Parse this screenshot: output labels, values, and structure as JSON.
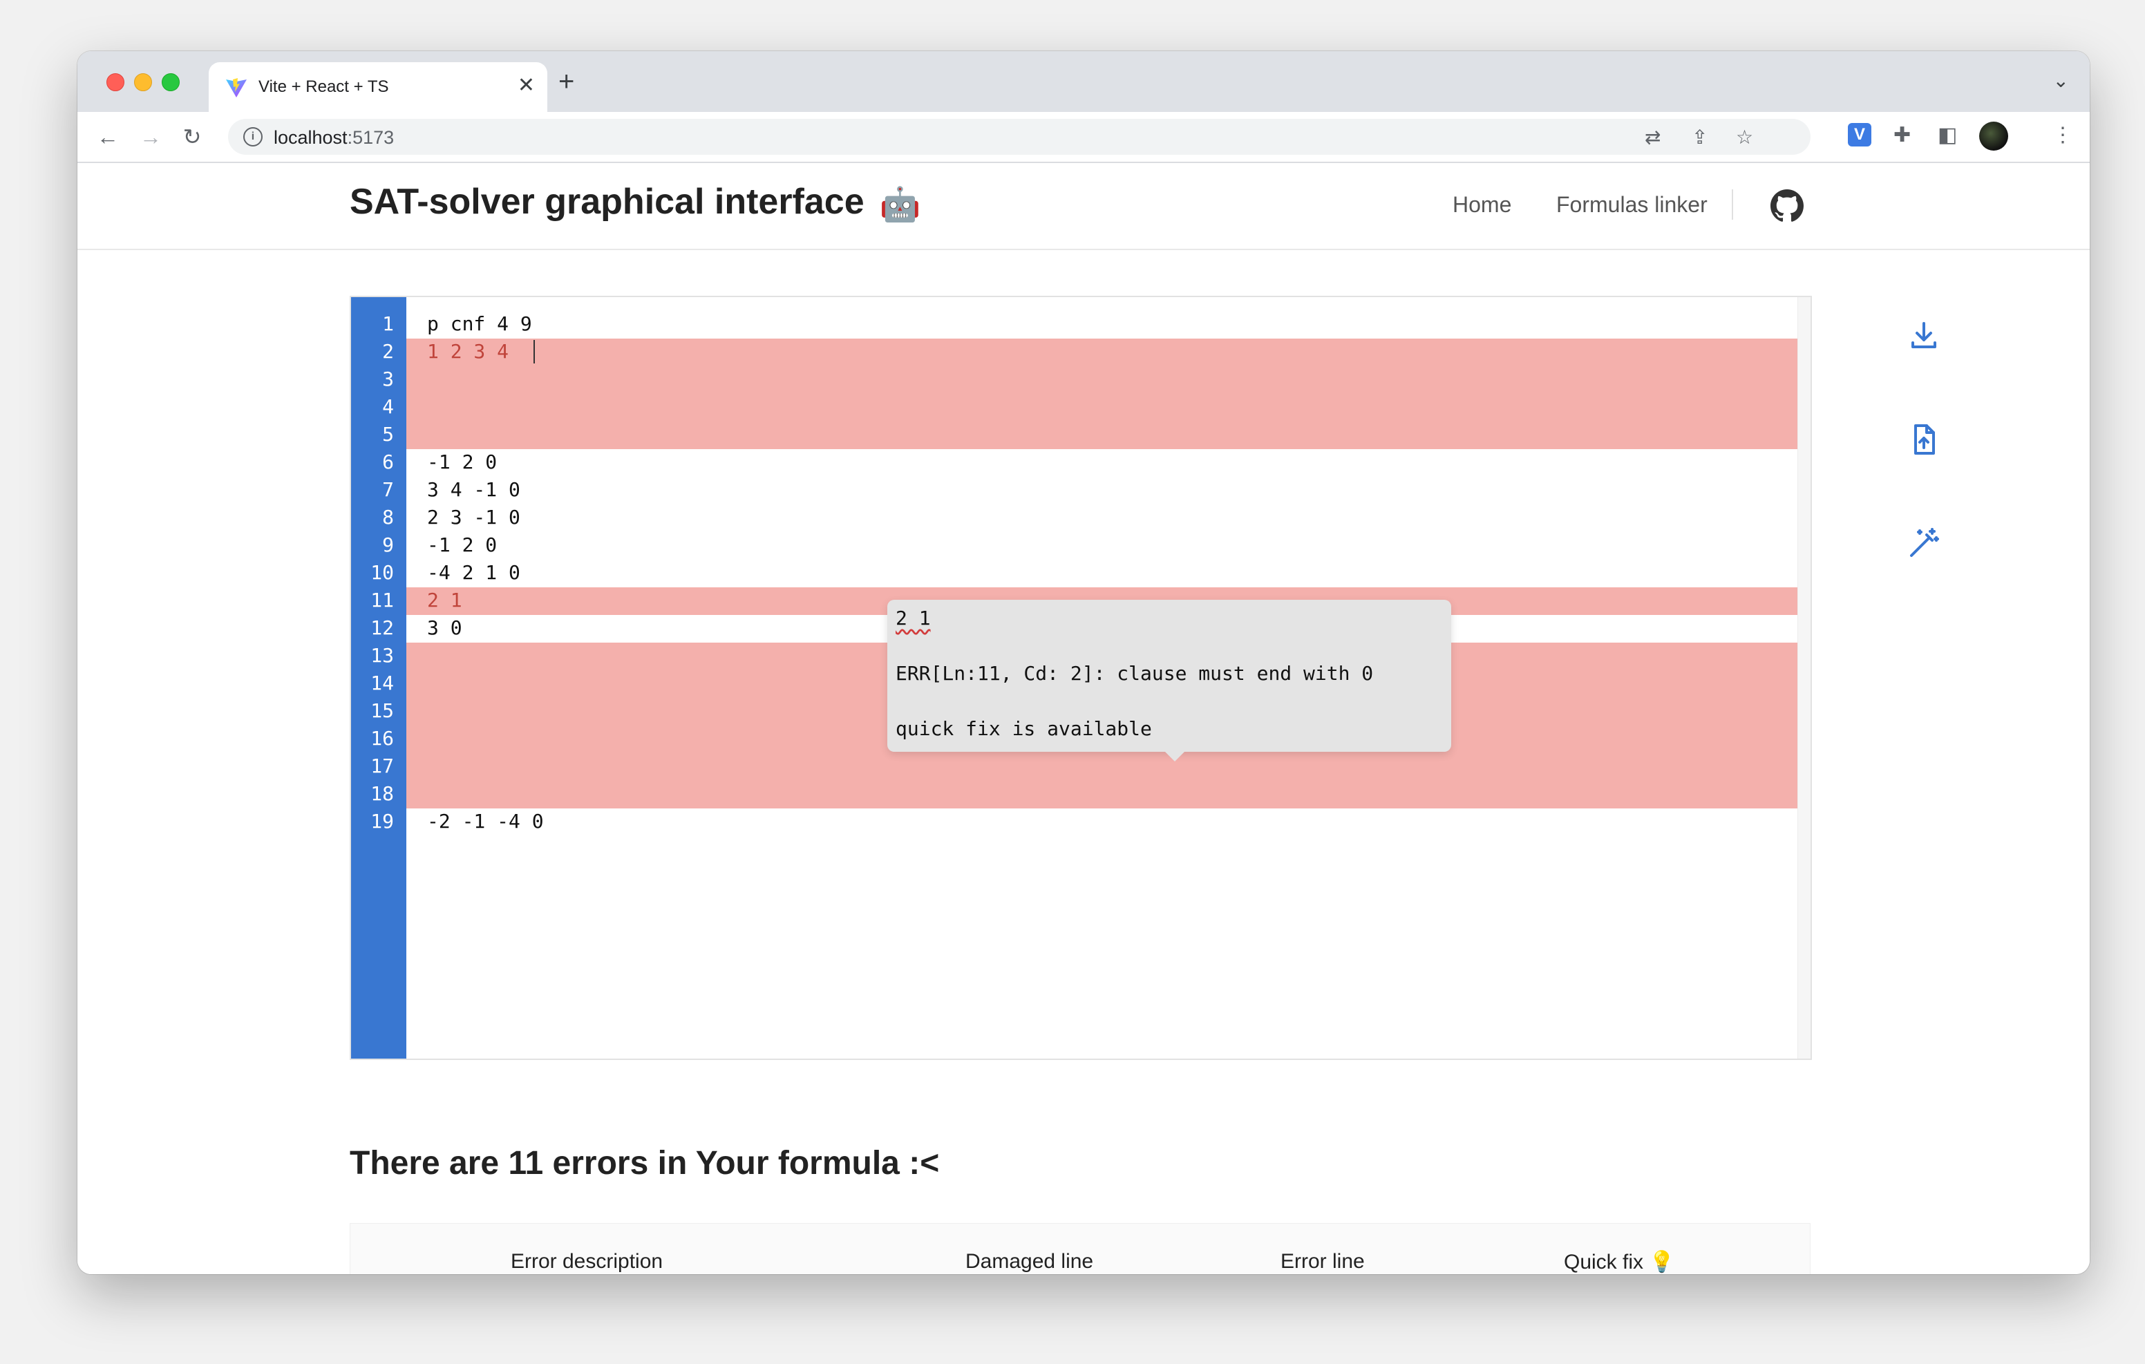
{
  "browser": {
    "tab_title": "Vite + React + TS",
    "url_host": "localhost",
    "url_port": ":5173"
  },
  "header": {
    "title": "SAT-solver graphical interface",
    "title_emoji": "🤖",
    "nav": [
      "Home",
      "Formulas linker"
    ]
  },
  "editor": {
    "line_numbers": [
      "1",
      "2",
      "3",
      "4",
      "5",
      "6",
      "7",
      "8",
      "9",
      "10",
      "11",
      "12",
      "13",
      "14",
      "15",
      "16",
      "17",
      "18",
      "19"
    ],
    "lines": {
      "l1": "p cnf 4 9",
      "l2": "1 2 3 4",
      "l6": "-1 2 0",
      "l7": "3 4 -1 0",
      "l8": "2 3 -1 0",
      "l9": "-1 2 0",
      "l10": "-4 2 1 0",
      "l11": "2 1",
      "l12": "3 0",
      "l19": "-2 -1 -4 0"
    },
    "error_line_numbers": [
      2,
      3,
      4,
      5,
      11,
      13,
      14,
      15,
      16,
      17,
      18
    ],
    "tooltip": {
      "title": "2 1",
      "message": "ERR[Ln:11, Cd: 2]: clause must end with 0",
      "hint": "quick fix is available"
    },
    "colors": {
      "gutter": "#3977d1",
      "error_band": "#f4b0ac",
      "tool_icons": "#3977d1"
    }
  },
  "tools": [
    "download-icon",
    "upload-file-icon",
    "magic-wand-icon"
  ],
  "errors": {
    "heading": "There are 11 errors in Your formula :<",
    "columns": [
      "Error description",
      "Damaged line",
      "Error line",
      "Quick fix 💡"
    ]
  }
}
